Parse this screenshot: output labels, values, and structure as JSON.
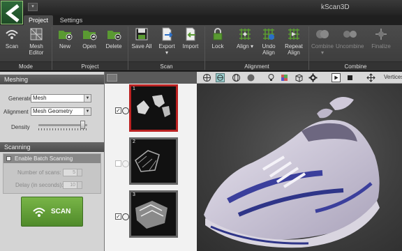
{
  "app": {
    "title": "kScan3D"
  },
  "tabs": [
    {
      "label": "Project",
      "active": true
    },
    {
      "label": "Settings",
      "active": false
    }
  ],
  "ribbon": {
    "mode": {
      "label": "Mode",
      "scan": "Scan",
      "mesh_editor_1": "Mesh",
      "mesh_editor_2": "Editor"
    },
    "project": {
      "label": "Project",
      "new": "New",
      "open": "Open",
      "delete": "Delete"
    },
    "scan": {
      "label": "Scan",
      "save_all": "Save All",
      "export": "Export",
      "import": "Import"
    },
    "alignment": {
      "label": "Alignment",
      "lock": "Lock",
      "align": "Align",
      "undo_align_1": "Undo",
      "undo_align_2": "Align",
      "repeat_align_1": "Repeat",
      "repeat_align_2": "Align"
    },
    "combine": {
      "label": "Combine",
      "combine": "Combine",
      "uncombine": "Uncombine",
      "finalize": "Finalize"
    }
  },
  "meshing": {
    "title": "Meshing",
    "generate_label": "Generate",
    "generate_value": "Mesh",
    "alignment_label": "Alignment",
    "alignment_value": "Mesh Geometry",
    "density_label": "Density",
    "density_level": 0.9
  },
  "scanning": {
    "title": "Scanning",
    "batch_label": "Enable Batch Scanning",
    "num_scans_label": "Number of scans:",
    "num_scans_value": "5",
    "delay_label": "Delay (in seconds):",
    "delay_value": "10",
    "scan_button": "SCAN"
  },
  "scans": [
    {
      "number": "1",
      "checked": true,
      "selected": true
    },
    {
      "number": "2",
      "checked": false,
      "selected": false
    },
    {
      "number": "3",
      "checked": true,
      "selected": false
    }
  ],
  "viewport": {
    "vertices_label": "Vertices"
  },
  "colors": {
    "accent_green": "#5a9a32",
    "selected_red": "#b22222",
    "ribbon_bg": "#444444"
  }
}
